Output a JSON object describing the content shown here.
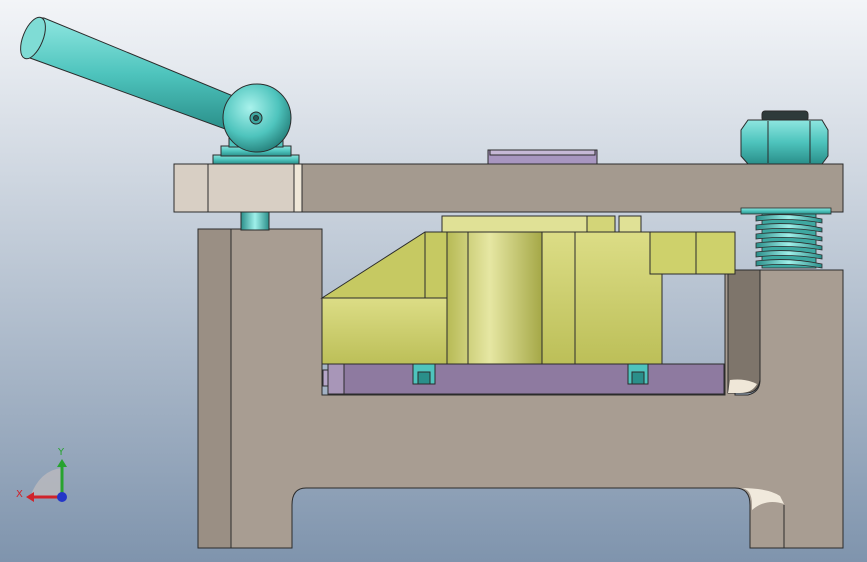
{
  "viewport": {
    "background_top": "#f3f5f8",
    "background_bottom": "#7f94ad"
  },
  "colors": {
    "frame": "#a89d92",
    "frame_dark": "#6e655c",
    "plate": "#a49a8f",
    "plate_light": "#d8cfc4",
    "fixture_yellow": "#cdd06a",
    "fixture_yellow_dark": "#a5a847",
    "fixture_yellow_light": "#e3e49a",
    "teal": "#4ec4bd",
    "teal_dark": "#2a8f8a",
    "purple": "#8e7aa0",
    "purple_light": "#b6a6c8",
    "outline": "#2b2b2b"
  },
  "parts": {
    "handle": "clamp-lever-handle",
    "ball": "lever-ball-joint",
    "nut": "hex-nut",
    "spring": "compression-spring",
    "clamp_plate": "top-clamp-plate",
    "body": "fixture-base-frame",
    "locator": "workpiece-locator-block",
    "base_plate": "purple-support-plate",
    "pad": "purple-pressure-pad"
  },
  "triad": {
    "x_label": "X",
    "y_label": "Y",
    "x_color": "#d0232a",
    "y_color": "#27a32f",
    "z_color": "#2436c8"
  }
}
